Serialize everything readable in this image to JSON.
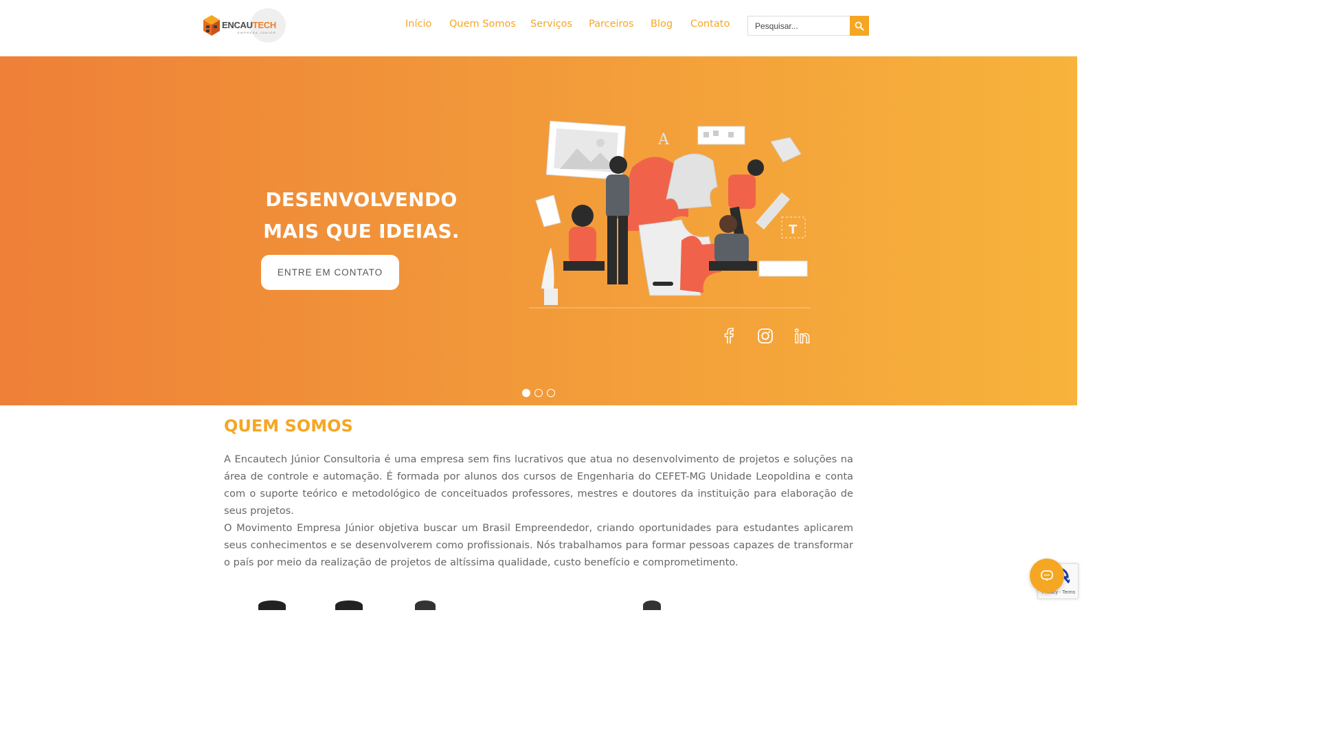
{
  "brand": {
    "name_left": "ENCAU",
    "name_right": "TECH",
    "tagline": "EMPRESA JÚNIOR"
  },
  "nav": {
    "items": [
      "Início",
      "Quem Somos",
      "Serviços",
      "Parceiros",
      "Blog",
      "Contato"
    ]
  },
  "search": {
    "placeholder": "Pesquisar..."
  },
  "hero": {
    "title_line1": "DESENVOLVENDO",
    "title_line2": "MAIS QUE IDEIAS.",
    "cta_label": "ENTRE EM CONTATO",
    "socials": [
      "facebook-icon",
      "instagram-icon",
      "linkedin-icon"
    ],
    "slides": {
      "count": 3,
      "active": 1
    }
  },
  "about": {
    "title": "QUEM SOMOS",
    "paragraph1": "A Encautech Júnior Consultoria é uma empresa sem fins lucrativos que atua no desenvolvimento de projetos e soluções na área de controle e automação. É formada por alunos dos cursos de Engenharia do CEFET-MG Unidade Leopoldina e conta com o suporte teórico e metodológico de conceituados professores, mestres e doutores da instituição para elaboração de seus projetos.",
    "paragraph2": "O Movimento Empresa Júnior objetiva buscar um Brasil Empreendedor, criando oportunidades para estudantes aplicarem seus conhecimentos e se desenvolverem como profissionais. Nós trabalhamos para formar pessoas capazes de transformar o país por meio da realização de projetos de altíssima qualidade, custo benefício e comprometimento."
  },
  "recaptcha": {
    "terms": "Privacy - Terms"
  },
  "colors": {
    "accent": "#f5a623",
    "hero_start": "#ee8037",
    "hero_end": "#f7b33b"
  }
}
